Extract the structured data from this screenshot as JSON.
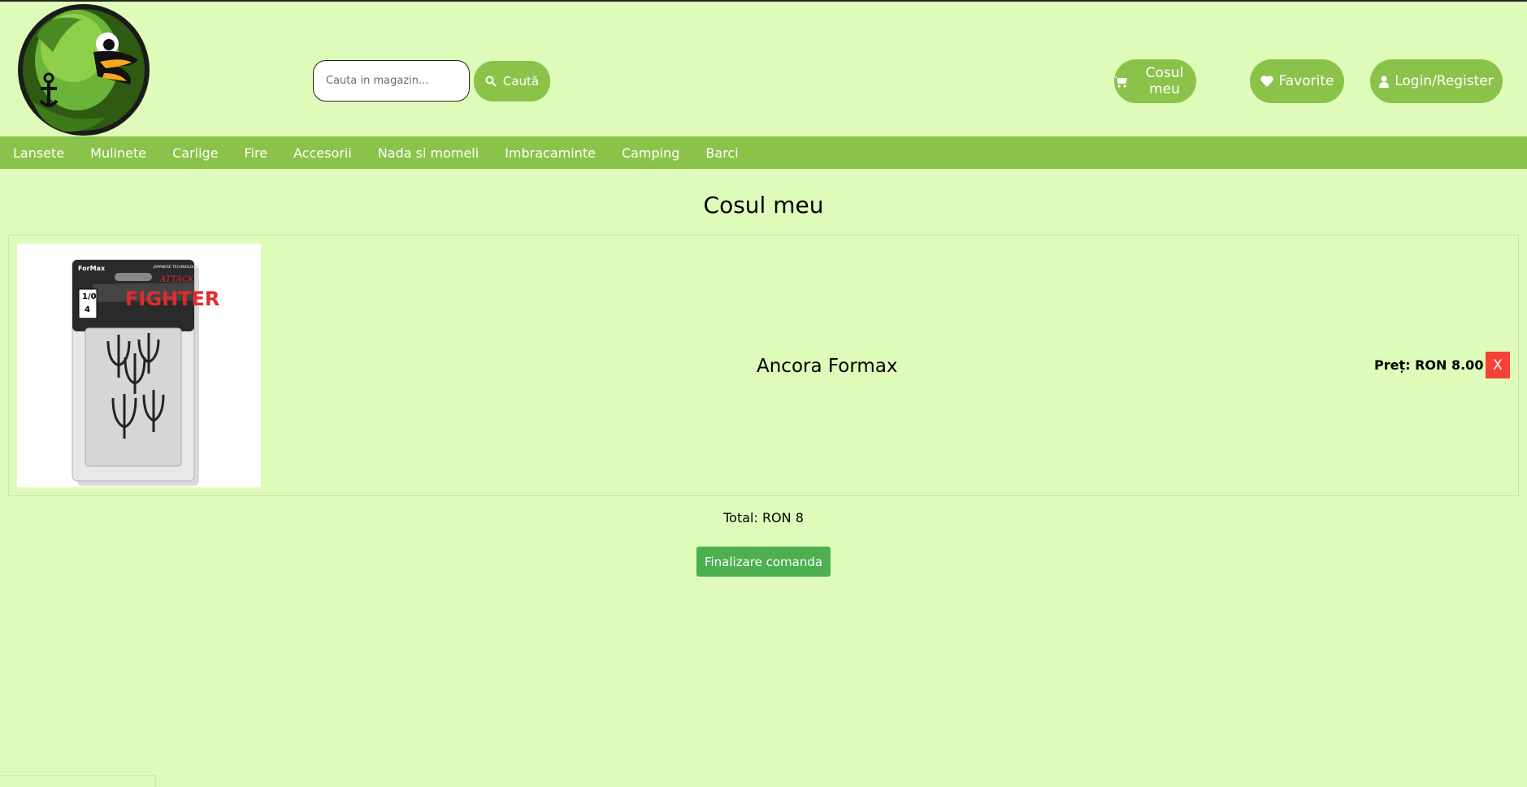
{
  "header": {
    "search": {
      "placeholder": "Cauta in magazin...",
      "value": "",
      "button_label": "Caută",
      "button_icon": "search-icon"
    },
    "cart_label": "Cosul meu",
    "cart_icon": "shopping-cart-icon",
    "favorites_label": "Favorite",
    "favorites_icon": "heart-icon",
    "login_label": "Login/Register",
    "login_icon": "user-icon",
    "logo_icon": "fish-logo-icon"
  },
  "nav": {
    "items": [
      {
        "label": "Lansete"
      },
      {
        "label": "Mulinete"
      },
      {
        "label": "Carlige"
      },
      {
        "label": "Fire"
      },
      {
        "label": "Accesorii"
      },
      {
        "label": "Nada si momeli"
      },
      {
        "label": "Imbracaminte"
      },
      {
        "label": "Camping"
      },
      {
        "label": "Barci"
      }
    ]
  },
  "main": {
    "title": "Cosul meu",
    "cart_items": [
      {
        "name": "Ancora Formax",
        "price_label": "Preț: RON 8.00",
        "remove_label": "X",
        "image": {
          "brand_text": "ForMax",
          "series_text": "FIGHTER",
          "sub_text": "ATTACK",
          "size_top": "1/0",
          "size_bottom": "4",
          "tagline": "JAPANESE TECHNOLOGY"
        }
      }
    ],
    "total_label": "Total: RON 8",
    "checkout_label": "Finalizare comanda"
  },
  "colors": {
    "background": "#dffbba",
    "accent": "#8bc34a",
    "checkout": "#4caf50",
    "remove": "#f44336"
  }
}
